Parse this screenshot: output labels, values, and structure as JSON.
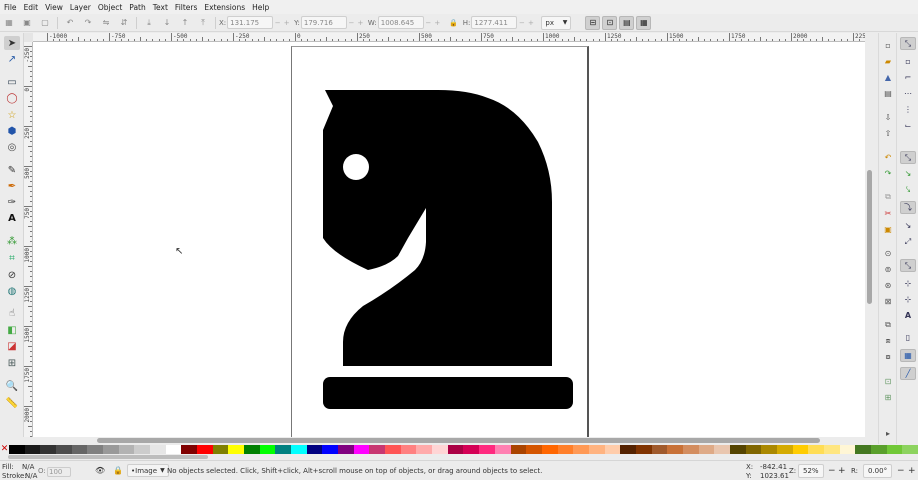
{
  "menu": [
    "File",
    "Edit",
    "View",
    "Layer",
    "Object",
    "Path",
    "Text",
    "Filters",
    "Extensions",
    "Help"
  ],
  "controls": {
    "x_label": "X:",
    "x_value": "131.175",
    "y_label": "Y:",
    "y_value": "179.716",
    "w_label": "W:",
    "w_value": "1008.645",
    "h_label": "H:",
    "h_value": "1277.411",
    "unit": "px",
    "minus": "−",
    "plus": "+",
    "lock_glyph": "🔒"
  },
  "ruler": {
    "h_labels": [
      "-1000",
      "-750",
      "-500",
      "-250",
      "0",
      "250",
      "500",
      "750",
      "1000",
      "1250",
      "1500",
      "1750",
      "2000",
      "2250"
    ],
    "v_labels": [
      "-250",
      "0",
      "250",
      "500",
      "750",
      "1000",
      "1250",
      "1500",
      "1750",
      "2000",
      "2250"
    ]
  },
  "palette": {
    "none_glyph": "✕",
    "colors": [
      "#000000",
      "#1a1a1a",
      "#333333",
      "#4d4d4d",
      "#666666",
      "#808080",
      "#999999",
      "#b3b3b3",
      "#cccccc",
      "#e6e6e6",
      "#ffffff",
      "#800000",
      "#ff0000",
      "#808000",
      "#ffff00",
      "#008000",
      "#00ff00",
      "#008080",
      "#00ffff",
      "#000080",
      "#0000ff",
      "#800080",
      "#ff00ff",
      "#c83771",
      "#ff5555",
      "#ff8080",
      "#ffaaaa",
      "#ffd5d5",
      "#aa0044",
      "#d40055",
      "#ff2a7f",
      "#ff80b2",
      "#aa4400",
      "#d45500",
      "#ff6600",
      "#ff7f2a",
      "#ff9955",
      "#ffb380",
      "#ffccaa",
      "#552200",
      "#803300",
      "#a05a2c",
      "#c87137",
      "#d38d5f",
      "#deaa87",
      "#e9c6af",
      "#554400",
      "#806600",
      "#aa8800",
      "#d4aa00",
      "#ffcc00",
      "#ffdd55",
      "#ffe680",
      "#fff6d5",
      "#447821",
      "#5aa02c",
      "#71c837",
      "#8dd35f"
    ]
  },
  "status": {
    "fill_label": "Fill:",
    "fill_value": "N/A",
    "stroke_label": "Stroke:",
    "stroke_value": "N/A",
    "opacity_label": "O:",
    "opacity_value": "100",
    "layer": "•Image",
    "message": "No objects selected. Click, Shift+click, Alt+scroll mouse on top of objects, or drag around objects to select.",
    "x_label": "X:",
    "x_value": "-842.41",
    "y_label": "Y:",
    "y_value": "1023.61",
    "zoom_label": "Z:",
    "zoom_value": "52%",
    "rotate_label": "R:",
    "rotate_value": "0.00°"
  }
}
